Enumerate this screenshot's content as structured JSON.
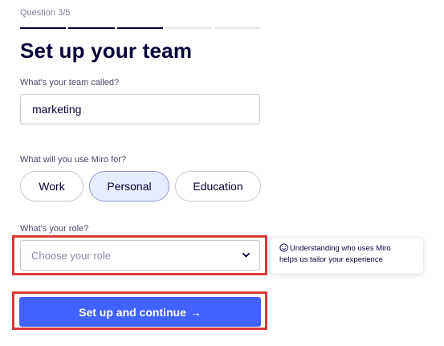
{
  "header": {
    "question_label": "Question 3/5",
    "progress": {
      "completed_steps": 3,
      "total_steps": 5
    }
  },
  "form": {
    "title": "Set up your team",
    "team_name": {
      "label": "What's your team called?",
      "value": "marketing"
    },
    "usage": {
      "label": "What will you use Miro for?",
      "options": [
        "Work",
        "Personal",
        "Education"
      ],
      "selected": "Personal"
    },
    "role": {
      "label": "What's your role?",
      "placeholder": "Choose your role"
    },
    "tooltip": {
      "line1": "Understanding who uses Miro",
      "line2": "helps us tailor your experience"
    },
    "submit": {
      "label": "Set up and continue",
      "arrow": "→"
    }
  },
  "colors": {
    "primary": "#4262ff",
    "highlight_border": "#d9393b",
    "selected_pill_bg": "#e8ecff",
    "text_dark": "#050038"
  }
}
